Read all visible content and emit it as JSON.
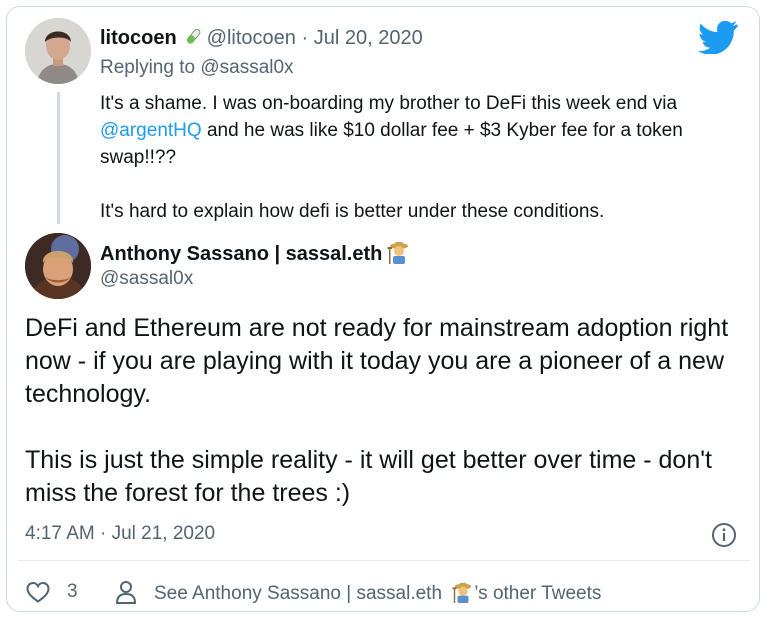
{
  "reply_tweet": {
    "display_name": "litocoen",
    "name_emoji": "test-tube-icon",
    "handle": "@litocoen",
    "separator": "·",
    "date": "Jul 20, 2020",
    "replying_prefix": "Replying to",
    "replying_to": "@sassal0x",
    "text_1_before": "It's a shame. I was on-boarding my brother to DeFi this week end via ",
    "text_1_mention": "@argentHQ",
    "text_1_after": " and he was like $10 dollar fee + $3 Kyber fee for a token swap!!??",
    "text_2": "It's hard to explain how defi is better under these conditions."
  },
  "main_tweet": {
    "display_name": "Anthony Sassano | sassal.eth",
    "name_emoji": "farmer-icon",
    "handle": "@sassal0x",
    "paragraph_1": "DeFi and Ethereum are not ready for mainstream adoption right now - if you are playing with it today you are a pioneer of a new technology.",
    "paragraph_2": "This is just the simple reality - it will get better over time - don't miss the forest for the trees :)",
    "timestamp": "4:17 AM · Jul 21, 2020"
  },
  "actions": {
    "like_count": "3",
    "see_prefix": "See Anthony Sassano | sassal.eth",
    "see_suffix": "’s other Tweets"
  },
  "colors": {
    "link": "#1d9bf0",
    "twitter_blue": "#1d9bf0",
    "muted_text": "#536471",
    "border": "#cfd9de"
  }
}
